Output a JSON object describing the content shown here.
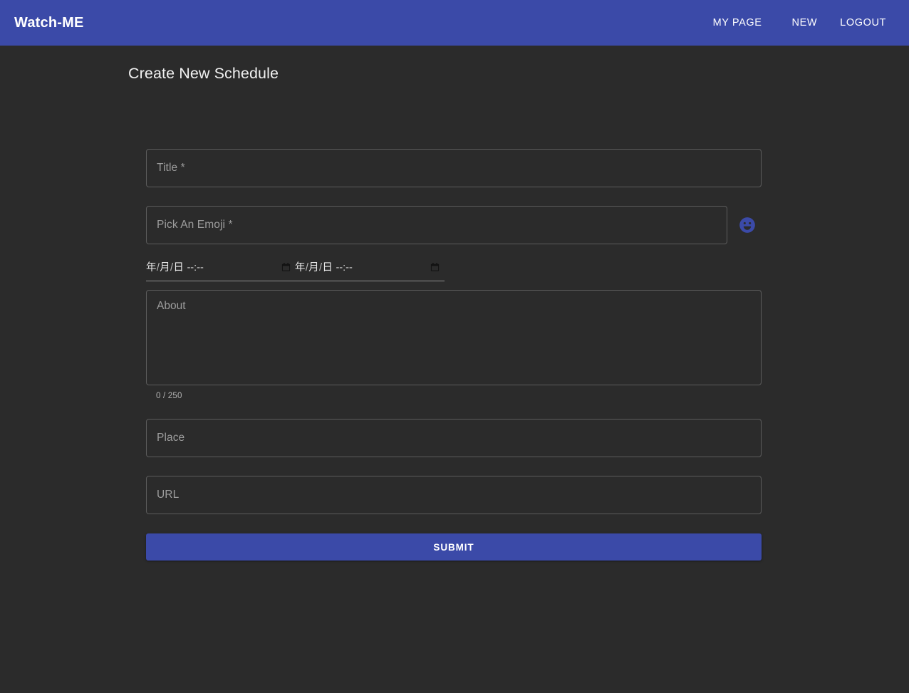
{
  "appbar": {
    "brand": "Watch-ME",
    "nav": [
      {
        "label": "MY PAGE",
        "name": "nav-my-page"
      },
      {
        "label": "NEW",
        "name": "nav-new"
      },
      {
        "label": "LOGOUT",
        "name": "nav-logout"
      }
    ]
  },
  "page": {
    "title": "Create New Schedule"
  },
  "form": {
    "title_field": {
      "placeholder": "Title *",
      "value": ""
    },
    "emoji_field": {
      "placeholder": "Pick An Emoji *",
      "value": ""
    },
    "emoji_button": {
      "icon": "smiley-face-icon"
    },
    "start_datetime": {
      "year": "年",
      "month": "月",
      "day": "日",
      "slash": "/",
      "time": "--:--",
      "value": "",
      "picker_icon": "calendar-icon"
    },
    "end_datetime": {
      "year": "年",
      "month": "月",
      "day": "日",
      "slash": "/",
      "time": "--:--",
      "value": "",
      "picker_icon": "calendar-icon"
    },
    "about_field": {
      "placeholder": "About",
      "value": ""
    },
    "about_counter": "0 / 250",
    "place_field": {
      "placeholder": "Place",
      "value": ""
    },
    "url_field": {
      "placeholder": "URL",
      "value": ""
    },
    "submit_button": {
      "label": "SUBMIT"
    }
  },
  "colors": {
    "brand_indigo": "#3b4aa8",
    "page_background": "#2b2b2b",
    "field_border": "#5c5c5c",
    "placeholder": "#9d9d9d",
    "text_primary": "#f1f1f1"
  }
}
